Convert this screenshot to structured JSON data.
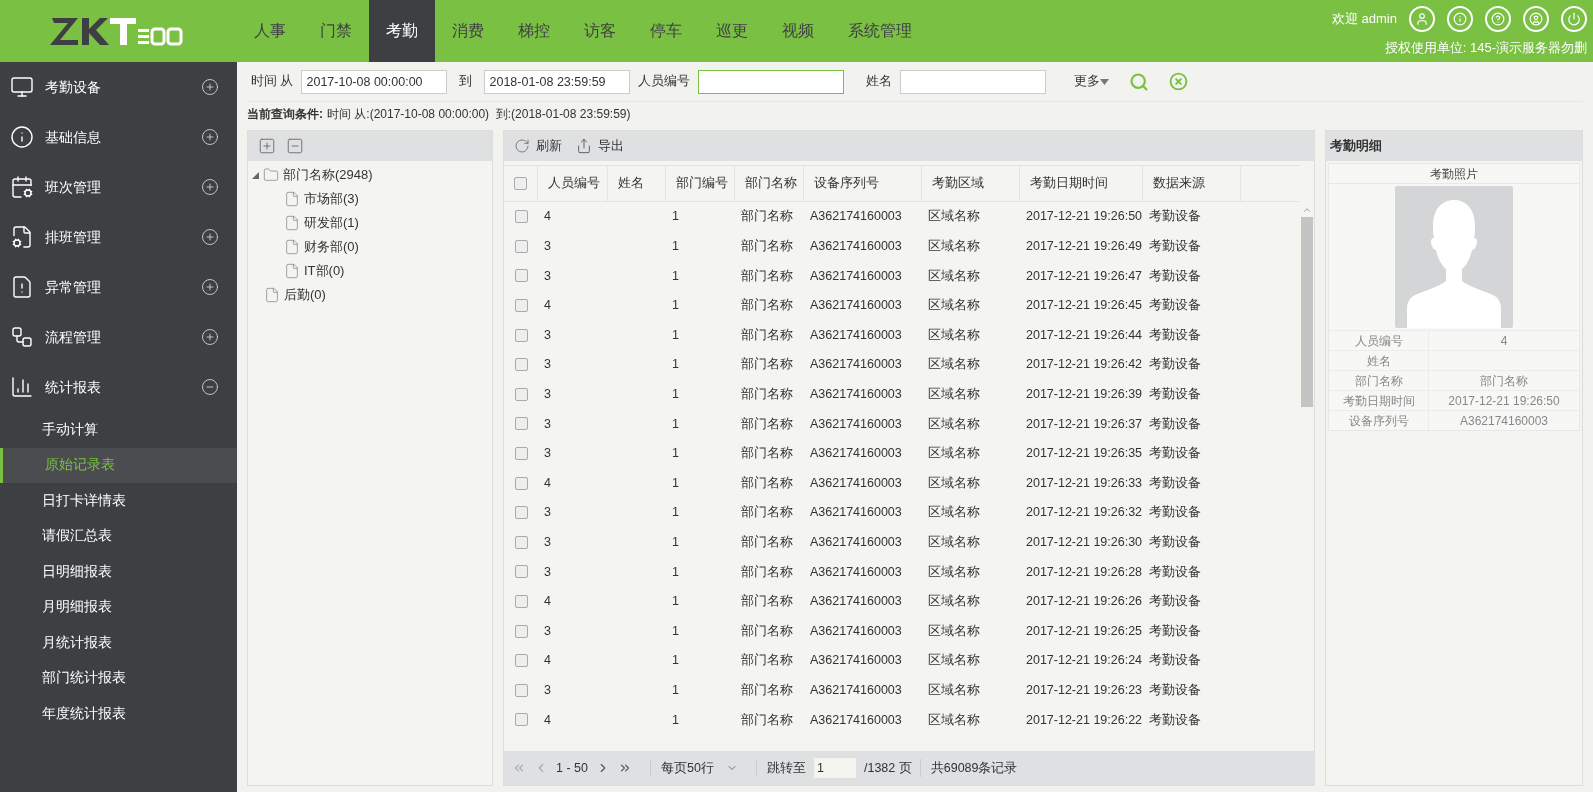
{
  "header": {
    "nav": [
      {
        "label": "人事",
        "selected": false
      },
      {
        "label": "门禁",
        "selected": false
      },
      {
        "label": "考勤",
        "selected": true
      },
      {
        "label": "消费",
        "selected": false
      },
      {
        "label": "梯控",
        "selected": false
      },
      {
        "label": "访客",
        "selected": false
      },
      {
        "label": "停车",
        "selected": false
      },
      {
        "label": "巡更",
        "selected": false
      },
      {
        "label": "视频",
        "selected": false
      },
      {
        "label": "系统管理",
        "selected": false
      }
    ],
    "welcome": "欢迎 admin",
    "license": "授权使用单位: 145-演示服务器勿删"
  },
  "sidebar": {
    "items": [
      {
        "label": "考勤设备",
        "kind": "device",
        "expanded": false
      },
      {
        "label": "基础信息",
        "kind": "info",
        "expanded": false
      },
      {
        "label": "班次管理",
        "kind": "shift",
        "expanded": false
      },
      {
        "label": "排班管理",
        "kind": "schedule",
        "expanded": false
      },
      {
        "label": "异常管理",
        "kind": "alert",
        "expanded": false
      },
      {
        "label": "流程管理",
        "kind": "flow",
        "expanded": false
      },
      {
        "label": "统计报表",
        "kind": "report",
        "expanded": true,
        "children": [
          {
            "label": "手动计算",
            "selected": false
          },
          {
            "label": "原始记录表",
            "selected": true
          },
          {
            "label": "日打卡详情表",
            "selected": false
          },
          {
            "label": "请假汇总表",
            "selected": false
          },
          {
            "label": "日明细报表",
            "selected": false
          },
          {
            "label": "月明细报表",
            "selected": false
          },
          {
            "label": "月统计报表",
            "selected": false
          },
          {
            "label": "部门统计报表",
            "selected": false
          },
          {
            "label": "年度统计报表",
            "selected": false
          }
        ]
      }
    ]
  },
  "filter": {
    "time_from_label": "时间 从",
    "time_from": "2017-10-08 00:00:00",
    "to_label": "到",
    "time_to": "2018-01-08 23:59:59",
    "person_id_label": "人员编号",
    "name_label": "姓名",
    "more": "更多",
    "condition_label": "当前查询条件:",
    "condition": "时间 从:(2017-10-08 00:00:00)  到:(2018-01-08 23:59:59)"
  },
  "tree": {
    "nodes": [
      {
        "label": "部门名称(2948)",
        "expanded": true,
        "children": [
          {
            "label": "市场部(3)"
          },
          {
            "label": "研发部(1)"
          },
          {
            "label": "财务部(0)"
          },
          {
            "label": "IT部(0)"
          }
        ]
      },
      {
        "label": "后勤(0)"
      }
    ]
  },
  "table": {
    "toolbar": [
      "刷新",
      "导出"
    ],
    "select_all_checked": false,
    "columns": [
      "人员编号",
      "姓名",
      "部门编号",
      "部门名称",
      "设备序列号",
      "考勤区域",
      "考勤日期时间",
      "数据来源"
    ],
    "rows": [
      {
        "checked": false,
        "cells": [
          "4",
          "",
          "1",
          "部门名称",
          "A362174160003",
          "区域名称",
          "2017-12-21 19:26:50",
          "考勤设备"
        ]
      },
      {
        "checked": false,
        "cells": [
          "3",
          "",
          "1",
          "部门名称",
          "A362174160003",
          "区域名称",
          "2017-12-21 19:26:49",
          "考勤设备"
        ]
      },
      {
        "checked": false,
        "cells": [
          "3",
          "",
          "1",
          "部门名称",
          "A362174160003",
          "区域名称",
          "2017-12-21 19:26:47",
          "考勤设备"
        ]
      },
      {
        "checked": false,
        "cells": [
          "4",
          "",
          "1",
          "部门名称",
          "A362174160003",
          "区域名称",
          "2017-12-21 19:26:45",
          "考勤设备"
        ]
      },
      {
        "checked": false,
        "cells": [
          "3",
          "",
          "1",
          "部门名称",
          "A362174160003",
          "区域名称",
          "2017-12-21 19:26:44",
          "考勤设备"
        ]
      },
      {
        "checked": false,
        "cells": [
          "3",
          "",
          "1",
          "部门名称",
          "A362174160003",
          "区域名称",
          "2017-12-21 19:26:42",
          "考勤设备"
        ]
      },
      {
        "checked": false,
        "cells": [
          "3",
          "",
          "1",
          "部门名称",
          "A362174160003",
          "区域名称",
          "2017-12-21 19:26:39",
          "考勤设备"
        ]
      },
      {
        "checked": false,
        "cells": [
          "3",
          "",
          "1",
          "部门名称",
          "A362174160003",
          "区域名称",
          "2017-12-21 19:26:37",
          "考勤设备"
        ]
      },
      {
        "checked": false,
        "cells": [
          "3",
          "",
          "1",
          "部门名称",
          "A362174160003",
          "区域名称",
          "2017-12-21 19:26:35",
          "考勤设备"
        ]
      },
      {
        "checked": false,
        "cells": [
          "4",
          "",
          "1",
          "部门名称",
          "A362174160003",
          "区域名称",
          "2017-12-21 19:26:33",
          "考勤设备"
        ]
      },
      {
        "checked": false,
        "cells": [
          "3",
          "",
          "1",
          "部门名称",
          "A362174160003",
          "区域名称",
          "2017-12-21 19:26:32",
          "考勤设备"
        ]
      },
      {
        "checked": false,
        "cells": [
          "3",
          "",
          "1",
          "部门名称",
          "A362174160003",
          "区域名称",
          "2017-12-21 19:26:30",
          "考勤设备"
        ]
      },
      {
        "checked": false,
        "cells": [
          "3",
          "",
          "1",
          "部门名称",
          "A362174160003",
          "区域名称",
          "2017-12-21 19:26:28",
          "考勤设备"
        ]
      },
      {
        "checked": false,
        "cells": [
          "4",
          "",
          "1",
          "部门名称",
          "A362174160003",
          "区域名称",
          "2017-12-21 19:26:26",
          "考勤设备"
        ]
      },
      {
        "checked": false,
        "cells": [
          "3",
          "",
          "1",
          "部门名称",
          "A362174160003",
          "区域名称",
          "2017-12-21 19:26:25",
          "考勤设备"
        ]
      },
      {
        "checked": false,
        "cells": [
          "4",
          "",
          "1",
          "部门名称",
          "A362174160003",
          "区域名称",
          "2017-12-21 19:26:24",
          "考勤设备"
        ]
      },
      {
        "checked": false,
        "cells": [
          "3",
          "",
          "1",
          "部门名称",
          "A362174160003",
          "区域名称",
          "2017-12-21 19:26:23",
          "考勤设备"
        ]
      },
      {
        "checked": false,
        "cells": [
          "4",
          "",
          "1",
          "部门名称",
          "A362174160003",
          "区域名称",
          "2017-12-21 19:26:22",
          "考勤设备"
        ]
      }
    ],
    "pager": {
      "range": "1 - 50",
      "page_size": "每页50行",
      "jump_label": "跳转至",
      "page": "1",
      "total_pages": "/1382 页",
      "total": "共69089条记录"
    }
  },
  "detail": {
    "title": "考勤明细",
    "photo_label": "考勤照片",
    "fields": [
      {
        "label": "人员编号",
        "value": "4"
      },
      {
        "label": "姓名"
      },
      {
        "label": "部门名称",
        "value": "部门名称"
      },
      {
        "label": "考勤日期时间",
        "value": "2017-12-21 19:26:50"
      },
      {
        "label": "设备序列号",
        "value": "A362174160003"
      }
    ]
  }
}
